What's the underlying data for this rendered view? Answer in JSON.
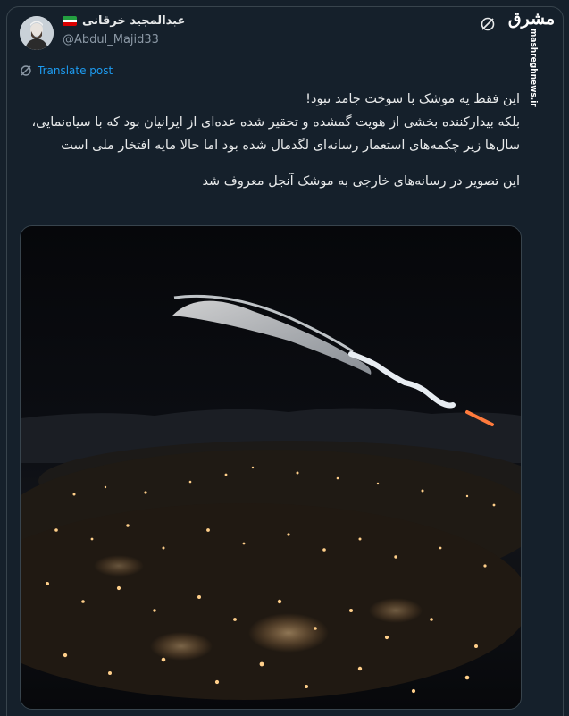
{
  "author": {
    "display_name": "عبدالمجید خرقانی",
    "handle": "@Abdul_Majid33",
    "flag": "iran-flag"
  },
  "translate": {
    "label": "Translate post"
  },
  "tweet": {
    "line1": "این فقط یه موشک با سوخت جامد نبود!",
    "paragraph1": "بلکه بیدارکننده بخشی از هویت گمشده و تحقیر شده عده‌ای از ایرانیان بود که با سیاه‌نمایی، سال‌ها زیر چکمه‌های استعمار رسانه‌ای لگدمال شده بود اما حالا مایه افتخار ملی است",
    "paragraph2": "این تصویر در رسانه‌های خارجی به موشک آنجل معروف شد"
  },
  "watermark": {
    "logo": "مشرق",
    "url": "mashreghnews.ir"
  },
  "media": {
    "description_icon": "night-rocket-photo"
  },
  "colors": {
    "background": "#15202b",
    "text": "#e7e9ea",
    "muted": "#8b98a5",
    "link": "#1d9bf0",
    "border": "#38444d"
  }
}
